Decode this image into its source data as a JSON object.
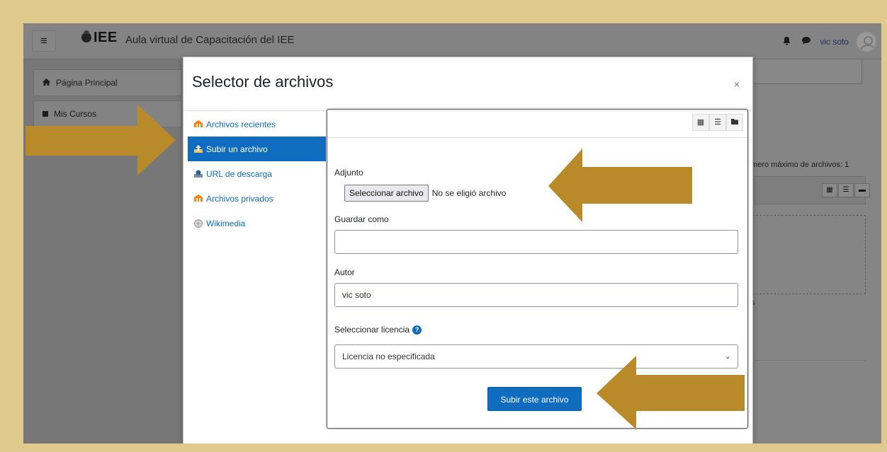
{
  "navbar": {
    "brand": "IEE",
    "site_title": "Aula virtual de Capacitación del IEE",
    "user_name": "vic soto"
  },
  "drawer": {
    "items": [
      {
        "label": "Página Principal",
        "icon": "home-icon"
      },
      {
        "label": "Mis Cursos",
        "icon": "square-icon"
      }
    ]
  },
  "background": {
    "max_files": "úmero máximo de archivos: 1",
    "partial_text": "s"
  },
  "modal": {
    "title": "Selector de archivos",
    "close": "×",
    "repositories": [
      {
        "label": "Archivos recientes",
        "icon": "recent-files-icon",
        "active": false
      },
      {
        "label": "Subir un archivo",
        "icon": "upload-icon",
        "active": true
      },
      {
        "label": "URL de descarga",
        "icon": "url-download-icon",
        "active": false
      },
      {
        "label": "Archivos privados",
        "icon": "private-files-icon",
        "active": false
      },
      {
        "label": "Wikimedia",
        "icon": "wikimedia-icon",
        "active": false
      }
    ],
    "form": {
      "attachment_label": "Adjunto",
      "choose_file_button": "Seleccionar archivo",
      "no_file_text": "No se eligió archivo",
      "save_as_label": "Guardar como",
      "save_as_value": "",
      "author_label": "Autor",
      "author_value": "vic soto",
      "license_label": "Seleccionar licencia",
      "license_value": "Licencia no especificada",
      "submit_button": "Subir este archivo"
    }
  },
  "colors": {
    "accent": "#0f6cbf",
    "frame": "#e0c98c",
    "arrow": "#b88a2a"
  }
}
